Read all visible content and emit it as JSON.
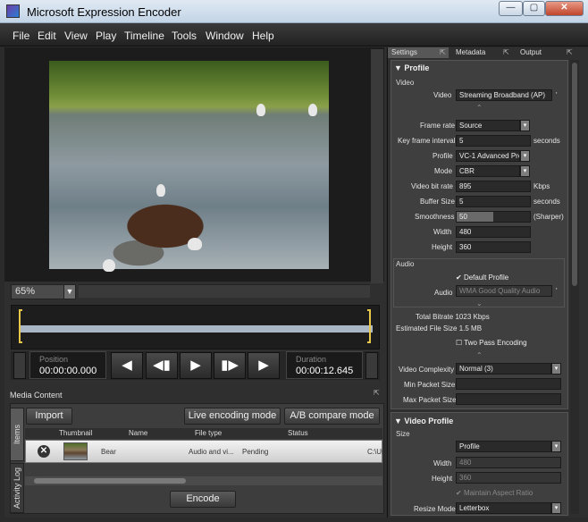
{
  "window": {
    "title": "Microsoft Expression Encoder",
    "controls": [
      "minimize",
      "maximize",
      "close"
    ]
  },
  "menu": [
    "File",
    "Edit",
    "View",
    "Play",
    "Timeline",
    "Tools",
    "Window",
    "Help"
  ],
  "viewer": {
    "zoom": "65%"
  },
  "transport": {
    "position_label": "Position",
    "position_value": "00:00:00.000",
    "duration_label": "Duration",
    "duration_value": "00:00:12.645"
  },
  "media_content": {
    "title": "Media Content",
    "import_label": "Import",
    "live_label": "Live encoding mode",
    "ab_label": "A/B compare mode",
    "side_tabs": [
      "Items",
      "Activity Log"
    ],
    "columns": [
      "Thumbnail",
      "Name",
      "File type",
      "Status"
    ],
    "row": {
      "name": "Bear",
      "file_type": "Audio and vi...",
      "status": "Pending",
      "path": "C:\\Us"
    },
    "encode_label": "Encode"
  },
  "panel": {
    "tabs": [
      "Settings",
      "Metadata",
      "Output"
    ],
    "profile": {
      "title": "Profile",
      "video_header": "Video",
      "video_label": "Video",
      "video_value": "Streaming Broadband (AP)",
      "frame_rate_label": "Frame rate",
      "frame_rate_value": "Source",
      "key_frame_label": "Key frame interval",
      "key_frame_value": "5",
      "key_frame_unit": "seconds",
      "profile_label": "Profile",
      "profile_value": "VC-1 Advanced Prof",
      "mode_label": "Mode",
      "mode_value": "CBR",
      "bitrate_label": "Video bit rate",
      "bitrate_value": "895",
      "bitrate_unit": "Kbps",
      "buffer_label": "Buffer Size",
      "buffer_value": "5",
      "buffer_unit": "seconds",
      "smooth_label": "Smoothness",
      "smooth_value": "50",
      "smooth_unit": "(Sharper)",
      "smooth_fraction": 0.5,
      "width_label": "Width",
      "width_value": "480",
      "height_label": "Height",
      "height_value": "360",
      "audio_header": "Audio",
      "default_profile_label": "Default Profile",
      "audio_label": "Audio",
      "audio_value": "WMA Good Quality Audio",
      "total_bitrate": "Total Bitrate 1023 Kbps",
      "est_file_size": "Estimated File Size 1.5 MB",
      "two_pass_label": "Two Pass Encoding",
      "complexity_label": "Video Complexity",
      "complexity_value": "Normal (3)",
      "min_packet_label": "Min Packet Size",
      "max_packet_label": "Max Packet Size"
    },
    "video_profile": {
      "title": "Video Profile",
      "size_header": "Size",
      "size_value": "Profile",
      "width_label": "Width",
      "width_value": "480",
      "height_label": "Height",
      "height_value": "360",
      "aspect_label": "Maintain Aspect Ratio",
      "resize_label": "Resize Mode",
      "resize_value": "Letterbox"
    }
  }
}
